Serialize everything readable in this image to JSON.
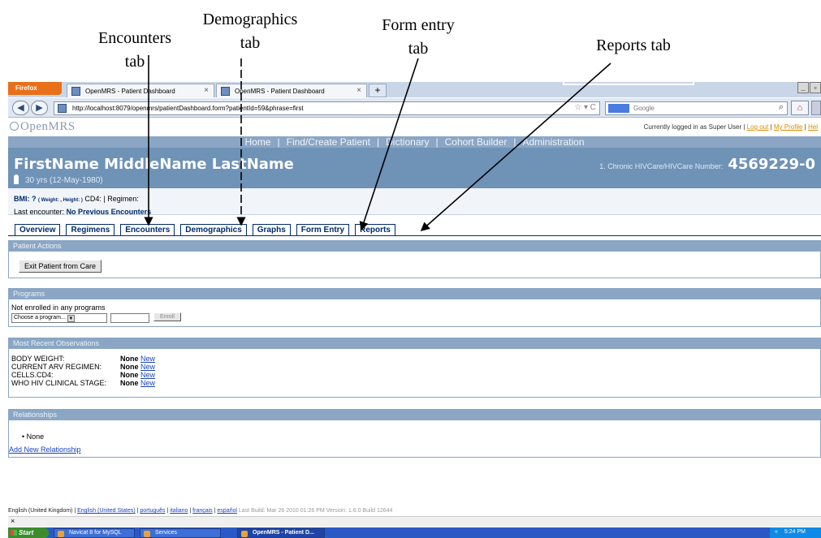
{
  "annotations": {
    "encounters": {
      "line1": "Encounters",
      "line2": "tab"
    },
    "demographics": {
      "line1": "Demographics",
      "line2": "tab"
    },
    "form_entry": {
      "line1": "Form entry",
      "line2": "tab"
    },
    "reports": {
      "label": "Reports tab"
    }
  },
  "browser": {
    "menu_button": "Firefox",
    "tabs": [
      {
        "title": "OpenMRS - Patient Dashboard",
        "close": "×"
      },
      {
        "title": "OpenMRS - Patient Dashboard",
        "close": "×"
      }
    ],
    "new_tab": "+",
    "url": "http://localhost:8079/openmrs/patientDashboard.form?patientId=59&phrase=first",
    "url_controls": "☆ ▾ C",
    "search_placeholder": "Google",
    "window_buttons": [
      "_",
      "▫"
    ]
  },
  "app": {
    "logo": "OpenMRS",
    "login_text": "Currently logged in as Super User",
    "logout": "Log out",
    "my_profile": "My Profile",
    "help": "Hel",
    "nav": [
      "Home",
      "Find/Create Patient",
      "Dictionary",
      "Cohort Builder",
      "Administration"
    ]
  },
  "patient": {
    "name": "FirstName MiddleName LastName",
    "age": "30 yrs (12-May-1980)",
    "id_label": "1. Chronic HIVCare/HIVCare Number:",
    "id_value": "4569229-0",
    "bmi_label": "BMI: ?",
    "bmi_detail": "( Weight: , Height: )",
    "cd4": "CD4:",
    "regimen": "Regimen:",
    "last_enc_label": "Last encounter:",
    "last_enc_value": "No Previous Encounters"
  },
  "tabs": [
    "Overview",
    "Regimens",
    "Encounters",
    "Demographics",
    "Graphs",
    "Form Entry",
    "Reports"
  ],
  "patient_actions": {
    "title": "Patient Actions",
    "exit_button": "Exit Patient from Care"
  },
  "programs": {
    "title": "Programs",
    "status": "Not enrolled in any programs",
    "select_value": "Choose a program...",
    "enroll_button": "Enroll"
  },
  "observations": {
    "title": "Most Recent Observations",
    "rows": [
      {
        "label": "BODY WEIGHT:",
        "value": "None",
        "link": "New"
      },
      {
        "label": "CURRENT ARV REGIMEN:",
        "value": "None",
        "link": "New"
      },
      {
        "label": "CELLS.CD4:",
        "value": "None",
        "link": "New"
      },
      {
        "label": "WHO HIV CLINICAL STAGE:",
        "value": "None",
        "link": "New"
      }
    ]
  },
  "relationships": {
    "title": "Relationships",
    "item": "None",
    "add_link": "Add New Relationship"
  },
  "footer": {
    "current_locale": "English (United Kingdom)",
    "locales": [
      "English (United States)",
      "português",
      "italiano",
      "français",
      "español"
    ],
    "build_info": "Last Build: Mar 26 2010 01:26 PM   Version: 1.6.0 Build 12644"
  },
  "findbar": {
    "close": "×"
  },
  "taskbar": {
    "start": "Start",
    "items": [
      "Navicat 8 for MySQL",
      "Services",
      "OpenMRS - Patient D..."
    ],
    "tray_chevron": "«",
    "clock": "5:24 PM"
  }
}
